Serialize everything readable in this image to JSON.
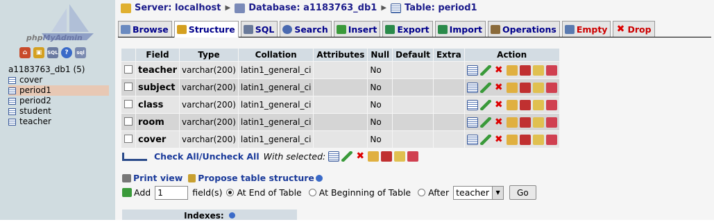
{
  "sidebar": {
    "logo_text_php": "php",
    "logo_text_admin": "MyAdmin",
    "icons": [
      "home-icon",
      "lock-icon",
      "sql-icon",
      "help-icon",
      "query-icon"
    ],
    "database": "a1183763_db1 (5)",
    "tables": [
      "cover",
      "period1",
      "period2",
      "student",
      "teacher"
    ],
    "selected_table": "period1"
  },
  "breadcrumb": {
    "server": "Server: localhost",
    "database": "Database: a1183763_db1",
    "table": "Table: period1"
  },
  "tabs": [
    {
      "label": "Browse",
      "icon": "browse-icon"
    },
    {
      "label": "Structure",
      "icon": "structure-icon"
    },
    {
      "label": "SQL",
      "icon": "sql-icon"
    },
    {
      "label": "Search",
      "icon": "search-icon"
    },
    {
      "label": "Insert",
      "icon": "insert-icon"
    },
    {
      "label": "Export",
      "icon": "export-icon"
    },
    {
      "label": "Import",
      "icon": "import-icon"
    },
    {
      "label": "Operations",
      "icon": "operations-icon"
    },
    {
      "label": "Empty",
      "icon": "empty-icon"
    },
    {
      "label": "Drop",
      "icon": "drop-icon"
    }
  ],
  "table": {
    "headers": [
      "Field",
      "Type",
      "Collation",
      "Attributes",
      "Null",
      "Default",
      "Extra",
      "Action"
    ],
    "rows": [
      {
        "field": "teacher",
        "type": "varchar(200)",
        "collation": "latin1_general_ci",
        "attributes": "",
        "null": "No",
        "default": "",
        "extra": ""
      },
      {
        "field": "subject",
        "type": "varchar(200)",
        "collation": "latin1_general_ci",
        "attributes": "",
        "null": "No",
        "default": "",
        "extra": ""
      },
      {
        "field": "class",
        "type": "varchar(200)",
        "collation": "latin1_general_ci",
        "attributes": "",
        "null": "No",
        "default": "",
        "extra": ""
      },
      {
        "field": "room",
        "type": "varchar(200)",
        "collation": "latin1_general_ci",
        "attributes": "",
        "null": "No",
        "default": "",
        "extra": ""
      },
      {
        "field": "cover",
        "type": "varchar(200)",
        "collation": "latin1_general_ci",
        "attributes": "",
        "null": "No",
        "default": "",
        "extra": ""
      }
    ],
    "action_icons": [
      "browse-distinct-icon",
      "edit-icon",
      "delete-icon",
      "primary-icon",
      "unique-icon",
      "index-icon",
      "fulltext-icon"
    ]
  },
  "bulk": {
    "check_all": "Check All",
    "separator": " / ",
    "uncheck_all": "Uncheck All",
    "with_selected": "With selected:"
  },
  "links": {
    "print_view": "Print view",
    "propose": "Propose table structure"
  },
  "add_fields": {
    "add_label": "Add",
    "count": "1",
    "fields_label": "field(s)",
    "opt_end": "At End of Table",
    "opt_begin": "At Beginning of Table",
    "opt_after": "After",
    "after_value": "teacher",
    "go": "Go"
  },
  "indexes_label": "Indexes:",
  "colors": {
    "sidebar_bg": "#d0dce0",
    "header_bg": "#d3dce3",
    "link": "#1a3a9a",
    "danger": "#cc0000"
  }
}
